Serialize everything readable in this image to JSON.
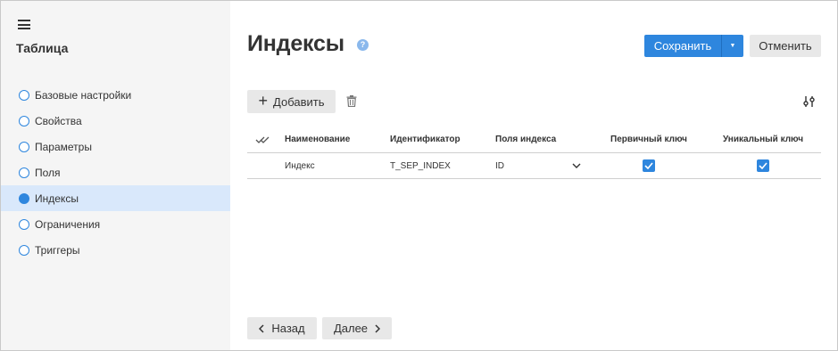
{
  "sidebar": {
    "title": "Таблица",
    "items": [
      {
        "label": "Базовые настройки",
        "active": false
      },
      {
        "label": "Свойства",
        "active": false
      },
      {
        "label": "Параметры",
        "active": false
      },
      {
        "label": "Поля",
        "active": false
      },
      {
        "label": "Индексы",
        "active": true
      },
      {
        "label": "Ограничения",
        "active": false
      },
      {
        "label": "Триггеры",
        "active": false
      }
    ]
  },
  "header": {
    "title": "Индексы",
    "help_glyph": "?",
    "save_label": "Сохранить",
    "save_arrow": "▼",
    "cancel_label": "Отменить"
  },
  "toolbar": {
    "add_label": "Добавить",
    "add_glyph": "+"
  },
  "table": {
    "columns": {
      "name": "Наименование",
      "identifier": "Идентификатор",
      "fields": "Поля индекса",
      "primary": "Первичный ключ",
      "unique": "Уникальный ключ"
    },
    "rows": [
      {
        "name": "Индекс",
        "identifier": "T_SEP_INDEX",
        "fields": "ID",
        "primary": true,
        "unique": true
      }
    ]
  },
  "footer": {
    "back_label": "Назад",
    "next_label": "Далее"
  },
  "colors": {
    "accent": "#2e86de",
    "sidebar_bg": "#f5f5f5",
    "active_bg": "#d9e8fb",
    "button_bg": "#e8e8e8"
  }
}
